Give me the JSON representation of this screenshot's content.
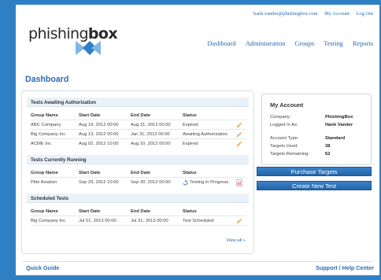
{
  "logo": {
    "text_part1": "phishing",
    "text_part2": "box"
  },
  "top_links": {
    "email": "hank.vander@phishingbox.com",
    "account": "My Account",
    "logout": "Log Out"
  },
  "nav": [
    "Dashboard",
    "Administration",
    "Groups",
    "Testing",
    "Reports"
  ],
  "page_title": "Dashboard",
  "columns": [
    "Group Name",
    "Start Date",
    "End Date",
    "Status"
  ],
  "sections": [
    {
      "title": "Tests Awaiting Authorization",
      "rows": [
        {
          "group": "ABC Company",
          "start": "Aug 19, 2012 00:00",
          "end": "Aug 31, 2012 00:00",
          "status": "Expired"
        },
        {
          "group": "Big Company Inc",
          "start": "Aug 13, 2012 00:00",
          "end": "Jan 31, 2013 00:00",
          "status": "Awaiting Authorization"
        },
        {
          "group": "ACME Inc",
          "start": "Aug 02, 2012 10:00",
          "end": "Aug 10, 2012 00:00",
          "status": "Expired"
        }
      ]
    },
    {
      "title": "Tests Currently Running",
      "rows": [
        {
          "group": "Pitts Aviation",
          "start": "Sep 29, 2012 10:00",
          "end": "Sep 30, 2012 00:00",
          "status": "Testing in Progress"
        }
      ]
    },
    {
      "title": "Scheduled Tests",
      "rows": [
        {
          "group": "Big Company Inc",
          "start": "Jul 01, 2013 00:00",
          "end": "Jul 31, 2013 00:00",
          "status": "Test Scheduled"
        }
      ]
    }
  ],
  "view_all": "View all »",
  "account": {
    "title": "My Account",
    "company_label": "Company:",
    "company": "PhishingBox",
    "user_label": "Logged In As:",
    "user": "Hank Vander",
    "type_label": "Account Type:",
    "type": "Standard",
    "targets_used_label": "Targets Used:",
    "targets_used": "38",
    "targets_remaining_label": "Targets Remaining:",
    "targets_remaining": "62"
  },
  "buttons": {
    "purchase": "Purchase Targets",
    "create": "Create New Test"
  },
  "footer": {
    "left": "Quick Guide",
    "right": "Support / Help Center"
  },
  "colors": {
    "brand_blue": "#2f7fc4",
    "link": "#2a67b0",
    "pencil": "#e8a23a"
  }
}
